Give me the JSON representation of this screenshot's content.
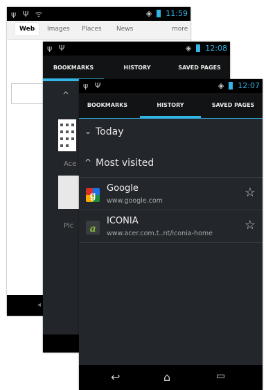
{
  "back_screen": {
    "status": {
      "icons_left": "ψ Ψ ᯤ",
      "time": "11:59"
    },
    "tabs": [
      "Web",
      "Images",
      "Places",
      "News",
      "more"
    ],
    "nav_glyph": "◂"
  },
  "middle_screen": {
    "status": {
      "icons_left": "ψ Ψ",
      "time": "12:08"
    },
    "tabs": [
      "BOOKMARKS",
      "HISTORY",
      "SAVED PAGES"
    ],
    "collapse_glyph": "^",
    "bookmark_label_1": "Ace",
    "bookmark_label_2": "Pic"
  },
  "front_screen": {
    "status": {
      "icons_left": "ψ Ψ",
      "time": "12:07"
    },
    "tabs": [
      "BOOKMARKS",
      "HISTORY",
      "SAVED PAGES"
    ],
    "sections": [
      {
        "chevron": "⌄",
        "label": "Today"
      },
      {
        "chevron": "^",
        "label": "Most visited"
      }
    ],
    "items": [
      {
        "title": "Google",
        "url": "www.google.com",
        "icon": "google-favicon"
      },
      {
        "title": "ICONIA",
        "url": "www.acer.com.t..nt/iconia-home",
        "icon": "iconia-favicon"
      }
    ],
    "star_glyph": "☆",
    "nav": {
      "back": "↩",
      "home": "⌂",
      "recents": "▭"
    }
  },
  "colors": {
    "accent": "#33b5e5",
    "dark_bg": "#23262b",
    "tab_bg": "#121314"
  }
}
